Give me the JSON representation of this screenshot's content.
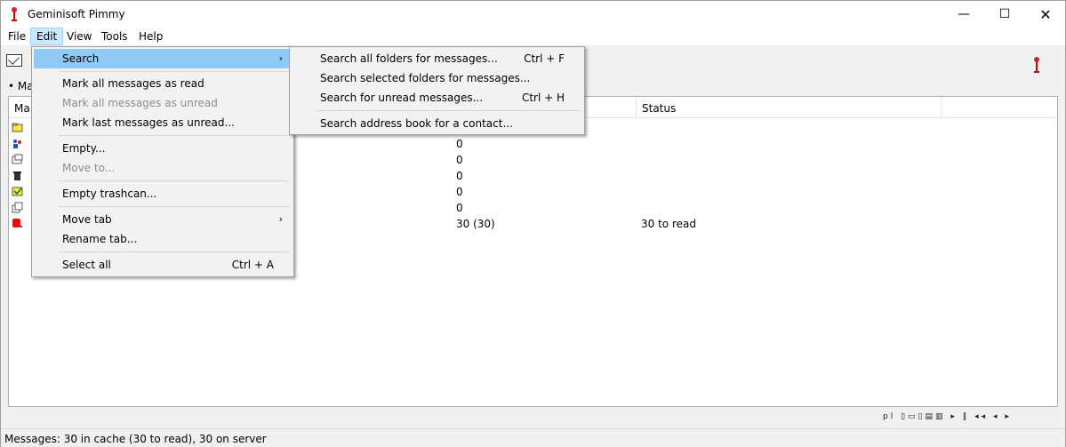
{
  "window": {
    "title": "Geminisoft Pimmy",
    "min_glyph": "—",
    "max_glyph": "☐",
    "close_glyph": "✕"
  },
  "menubar": {
    "items": [
      "File",
      "Edit",
      "View",
      "Tools",
      "Help"
    ]
  },
  "tab": {
    "label": "• Ma"
  },
  "list": {
    "columns": [
      "Ma",
      "Status"
    ],
    "rows": [
      {
        "icon": "folder-icon",
        "count": "",
        "status": ""
      },
      {
        "icon": "users-icon",
        "count": "0",
        "status": ""
      },
      {
        "icon": "outbox-icon",
        "count": "0",
        "status": ""
      },
      {
        "icon": "trash-icon",
        "count": "0",
        "status": ""
      },
      {
        "icon": "checked-icon",
        "count": "0",
        "status": ""
      },
      {
        "icon": "drafts-icon",
        "count": "0",
        "status": ""
      },
      {
        "icon": "inbox-icon",
        "count": "30 (30)",
        "status": "30 to read"
      }
    ]
  },
  "edit_menu": {
    "items": [
      {
        "label": "Search",
        "submenu": true
      },
      {
        "label": "Mark all messages as read"
      },
      {
        "label": "Mark all messages as unread",
        "disabled": true
      },
      {
        "label": "Mark last messages as unread..."
      },
      {
        "label": "Empty..."
      },
      {
        "label": "Move to...",
        "disabled": true
      },
      {
        "label": "Empty trashcan..."
      },
      {
        "label": "Move tab",
        "submenu": true
      },
      {
        "label": "Rename tab..."
      },
      {
        "label": "Select all",
        "shortcut": "Ctrl + A"
      }
    ],
    "arrow_glyph": "›"
  },
  "search_submenu": {
    "items": [
      {
        "label": "Search all folders for  messages...",
        "shortcut": "Ctrl + F"
      },
      {
        "label": "Search selected folders for messages..."
      },
      {
        "label": "Search for unread messages...",
        "shortcut": "Ctrl + H"
      },
      {
        "label": "Search address book for a contact..."
      }
    ]
  },
  "navstrip": {
    "glyphs": "pl ▯▭▯▤▥ ▸ ‖ ◂◂ ◂ ▸"
  },
  "statusbar": {
    "text": "Messages: 30 in cache (30 to read), 30 on server"
  },
  "colors": {
    "menu_highlight": "#91c9f7",
    "menubar_active": "#cce8ff",
    "disabled_text": "#8d8d8d"
  }
}
